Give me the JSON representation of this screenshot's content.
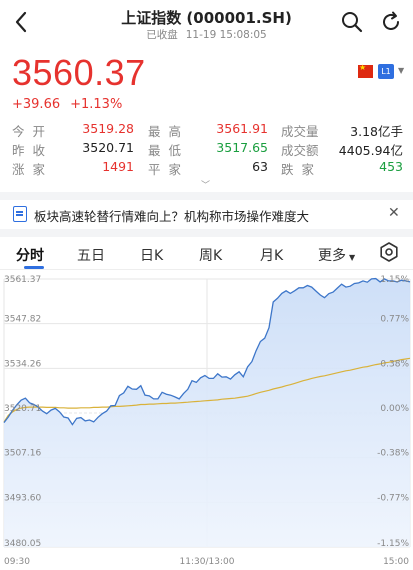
{
  "header": {
    "title": "上证指数 (000001.SH)",
    "status": "已收盘",
    "datetime": "11-19 15:08:05"
  },
  "quote": {
    "price": "3560.37",
    "change": "+39.66",
    "change_pct": "+1.13%",
    "badge": "L1"
  },
  "stats": {
    "open_label": "今开",
    "open": "3519.28",
    "high_label": "最高",
    "high": "3561.91",
    "volume_label": "成交量",
    "volume": "3.18亿手",
    "prev_close_label": "昨收",
    "prev_close": "3520.71",
    "low_label": "最低",
    "low": "3517.65",
    "amount_label": "成交额",
    "amount": "4405.94亿",
    "up_label": "涨家",
    "up": "1491",
    "flat_label": "平家",
    "flat": "63",
    "down_label": "跌家",
    "down": "453"
  },
  "news": {
    "text": "板块高速轮替行情难向上？机构称市场操作难度大"
  },
  "tabs": [
    "分时",
    "五日",
    "日K",
    "周K",
    "月K",
    "更多"
  ],
  "colors": {
    "up": "#e6322e",
    "down": "#1a9e3f",
    "accent": "#2f6fe0",
    "price_line": "#3d76c9",
    "avg_line": "#d9b23a"
  },
  "chart_data": {
    "type": "line",
    "title": "",
    "xlabel": "",
    "ylabel": "",
    "ylim": [
      3480.05,
      3561.37
    ],
    "y_ticks": [
      "3561.37",
      "3547.82",
      "3534.26",
      "3520.71",
      "3507.16",
      "3493.60",
      "3480.05"
    ],
    "pct_ticks": [
      "1.15%",
      "0.77%",
      "0.38%",
      "0.00%",
      "-0.38%",
      "-0.77%",
      "-1.15%"
    ],
    "x_ticks": [
      "09:30",
      "11:30/13:00",
      "15:00"
    ],
    "prev_close": 3520.71,
    "series": [
      {
        "values": [
          3517.8,
          3519.5,
          3521.5,
          3523.2,
          3524.6,
          3525.2,
          3523.8,
          3523.3,
          3522.5,
          3521.3,
          3520.5,
          3521.6,
          3522.1,
          3521.0,
          3519.5,
          3519.2,
          3517.2,
          3519.1,
          3519.3,
          3518.3,
          3518.6,
          3518.0,
          3519.4,
          3520.5,
          3521.3,
          3522.9,
          3523.0,
          3526.0,
          3526.8,
          3528.8,
          3528.0,
          3527.9,
          3529.0,
          3526.1,
          3525.9,
          3525.0,
          3525.0,
          3527.0,
          3526.4,
          3526.1,
          3525.6,
          3525.0,
          3526.6,
          3527.9,
          3530.5,
          3530.0,
          3531.4,
          3532.1,
          3531.2,
          3531.2,
          3532.6,
          3531.6,
          3531.7,
          3531.0,
          3532.3,
          3533.2,
          3531.7,
          3534.7,
          3536.3,
          3539.6,
          3542.4,
          3543.4,
          3546.6,
          3554.4,
          3555.5,
          3557.0,
          3557.8,
          3557.0,
          3557.8,
          3558.7,
          3558.7,
          3559.4,
          3558.9,
          3557.7,
          3556.5,
          3555.7,
          3556.9,
          3557.4,
          3558.6,
          3559.8,
          3558.9,
          3559.2,
          3560.0,
          3560.2,
          3560.8,
          3560.4,
          3561.4,
          3561.5,
          3560.5,
          3561.4,
          3560.8,
          3560.8,
          3560.5,
          3561.0,
          3560.8,
          3560.5
        ]
      },
      {
        "values": [
          3518.0,
          3520.0,
          3521.0,
          3521.8,
          3522.2,
          3522.4,
          3522.5,
          3522.5,
          3522.5,
          3522.5,
          3522.4,
          3522.4,
          3522.4,
          3522.3,
          3522.3,
          3522.2,
          3522.2,
          3522.2,
          3522.3,
          3522.3,
          3522.3,
          3522.4,
          3522.4,
          3522.5,
          3522.5,
          3522.6,
          3522.7,
          3522.7,
          3522.8,
          3522.9,
          3523.0,
          3523.1,
          3523.3,
          3523.3,
          3523.4,
          3523.4,
          3523.5,
          3523.6,
          3523.6,
          3523.7,
          3523.7,
          3523.8,
          3523.9,
          3524.0,
          3524.1,
          3524.2,
          3524.3,
          3524.4,
          3524.5,
          3524.6,
          3524.7,
          3524.9,
          3525.0,
          3525.1,
          3525.2,
          3525.4,
          3525.6,
          3525.8,
          3526.2,
          3526.6,
          3527.0,
          3527.3,
          3527.6,
          3528.0,
          3528.3,
          3528.6,
          3529.0,
          3529.3,
          3529.7,
          3530.1,
          3530.5,
          3530.8,
          3531.2,
          3531.5,
          3531.8,
          3532.0,
          3532.3,
          3532.6,
          3532.9,
          3533.2,
          3533.5,
          3533.7,
          3534.0,
          3534.3,
          3534.6,
          3534.8,
          3535.1,
          3535.4,
          3535.6,
          3535.9,
          3536.1,
          3536.4,
          3536.6,
          3536.9,
          3537.1,
          3537.3
        ]
      }
    ]
  }
}
